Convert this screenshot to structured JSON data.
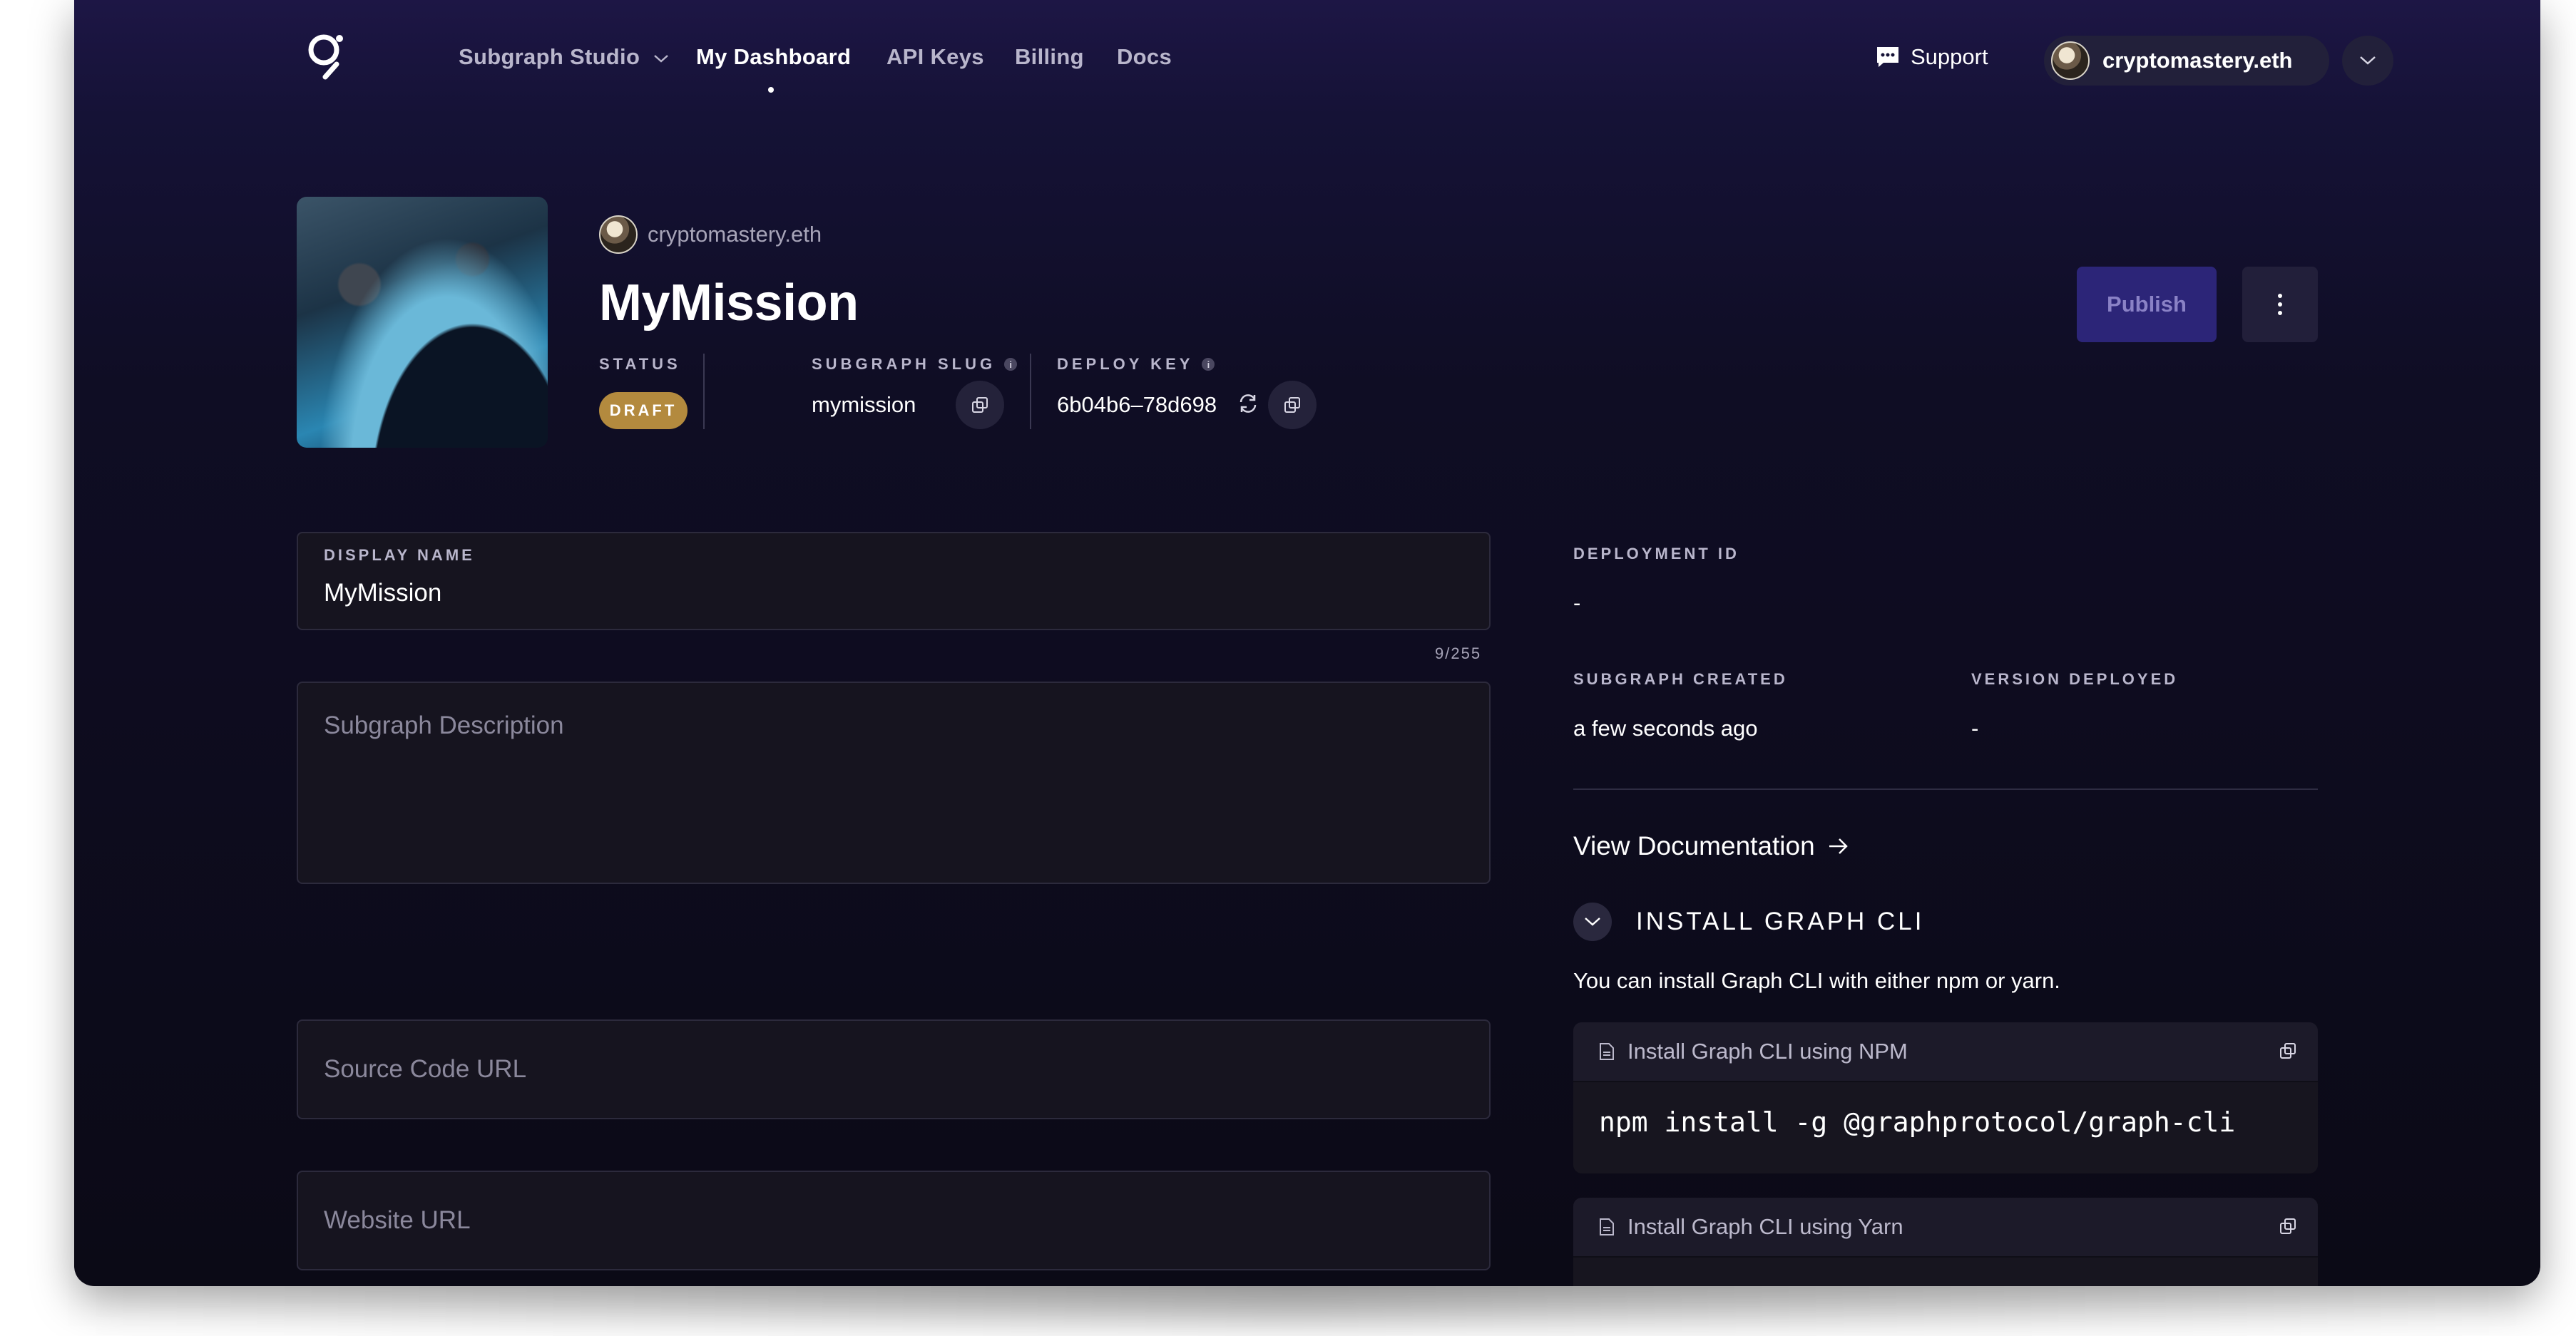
{
  "nav": {
    "brand_dropdown": "Subgraph Studio",
    "items": [
      {
        "label": "My Dashboard",
        "active": true
      },
      {
        "label": "API Keys",
        "active": false
      },
      {
        "label": "Billing",
        "active": false
      },
      {
        "label": "Docs",
        "active": false
      }
    ],
    "support_label": "Support",
    "user_name": "cryptomastery.eth"
  },
  "header": {
    "owner": "cryptomastery.eth",
    "title": "MyMission",
    "status_label": "STATUS",
    "status_badge": "DRAFT",
    "slug_label": "SUBGRAPH SLUG",
    "slug_value": "mymission",
    "deploy_key_label": "DEPLOY KEY",
    "deploy_key_value": "6b04b6–78d698",
    "publish_label": "Publish"
  },
  "form": {
    "display_name_label": "DISPLAY NAME",
    "display_name_value": "MyMission",
    "display_name_counter": "9/255",
    "description_placeholder": "Subgraph Description",
    "source_code_placeholder": "Source Code URL",
    "website_placeholder": "Website URL"
  },
  "details": {
    "deployment_id_label": "DEPLOYMENT ID",
    "deployment_id_value": "-",
    "created_label": "SUBGRAPH CREATED",
    "created_value": "a few seconds ago",
    "version_label": "VERSION DEPLOYED",
    "version_value": "-",
    "view_docs": "View Documentation",
    "install_title": "INSTALL GRAPH CLI",
    "install_desc": "You can install Graph CLI with either npm or yarn.",
    "npm_card_title": "Install Graph CLI using NPM",
    "npm_command": "npm install -g @graphprotocol/graph-cli",
    "yarn_card_title": "Install Graph CLI using Yarn"
  },
  "colors": {
    "accent": "#2c2578",
    "draft_badge": "#b38a3e",
    "background_top": "#1d1645",
    "background_bottom": "#0b0a16"
  }
}
